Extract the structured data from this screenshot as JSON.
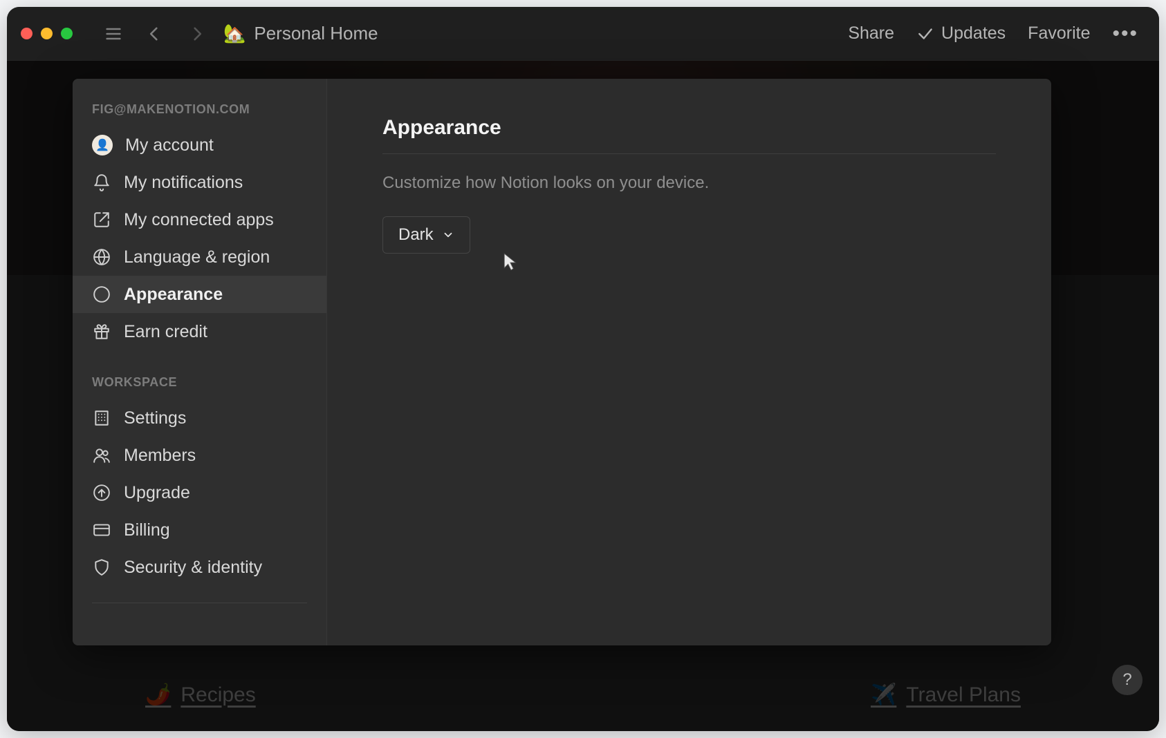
{
  "titlebar": {
    "page_icon": "🏡",
    "page_title": "Personal Home",
    "share_label": "Share",
    "updates_label": "Updates",
    "favorite_label": "Favorite"
  },
  "background_page": {
    "link_left_icon": "🌶️",
    "link_left_label": "Recipes",
    "link_right_icon": "✈️",
    "link_right_label": "Travel Plans"
  },
  "settings": {
    "account_header": "FIG@MAKENOTION.COM",
    "account_items": [
      {
        "label": "My account"
      },
      {
        "label": "My notifications"
      },
      {
        "label": "My connected apps"
      },
      {
        "label": "Language & region"
      },
      {
        "label": "Appearance"
      },
      {
        "label": "Earn credit"
      }
    ],
    "workspace_header": "WORKSPACE",
    "workspace_items": [
      {
        "label": "Settings"
      },
      {
        "label": "Members"
      },
      {
        "label": "Upgrade"
      },
      {
        "label": "Billing"
      },
      {
        "label": "Security & identity"
      }
    ],
    "panel": {
      "title": "Appearance",
      "description": "Customize how Notion looks on your device.",
      "theme_value": "Dark"
    }
  },
  "help_label": "?"
}
